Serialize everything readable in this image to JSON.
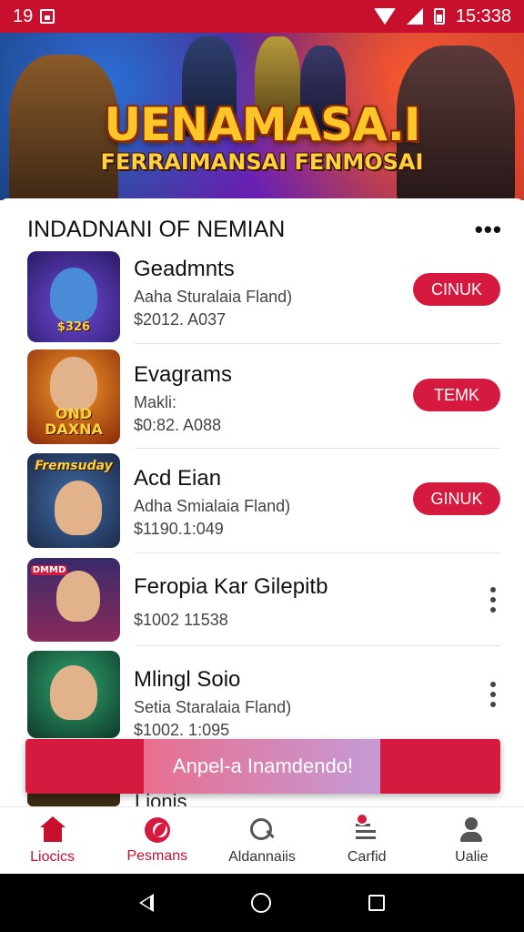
{
  "status_bar": {
    "left_text": "19",
    "time": "15:338"
  },
  "banner": {
    "title": "UENAMASA.I",
    "subtitle": "FERRAIMANSAI FENMOSAI"
  },
  "section": {
    "title": "INDADNANI OF NEMIAN"
  },
  "items": [
    {
      "name": "Geadmnts",
      "desc": "Aaha Sturalaia Fland)",
      "price": "$2012. A037",
      "action": "CINUK",
      "art_text": "$326"
    },
    {
      "name": "Evagrams",
      "desc": "Makli:",
      "price": "$0:82. A088",
      "action": "TEMK",
      "art_text": "OND DAXNA"
    },
    {
      "name": "Acd Eian",
      "desc": "Adha Smialaia Fland)",
      "price": "$1190.1:049",
      "action": "GINUK",
      "art_text": "Fremsuday"
    },
    {
      "name": "Feropia Kar Gilepitb",
      "desc": "",
      "price": "$1002 11538",
      "action": "",
      "art_text": "DMMD"
    },
    {
      "name": "Mlingl Soio",
      "desc": "Setia Staralaia Fland)",
      "price": "$1002. 1:095",
      "action": "",
      "art_text": ""
    }
  ],
  "peek_item": {
    "name": "Lionis"
  },
  "snackbar": {
    "text": "Anpel-a Inamdendo!"
  },
  "bottom_nav": [
    {
      "label": "Liocics",
      "icon": "home-icon",
      "active": true
    },
    {
      "label": "Pesmans",
      "icon": "compass-icon",
      "active": false
    },
    {
      "label": "Aldannaiis",
      "icon": "search-icon",
      "active": false
    },
    {
      "label": "Carfid",
      "icon": "list-icon",
      "active": false
    },
    {
      "label": "Ualie",
      "icon": "user-icon",
      "active": false
    }
  ],
  "colors": {
    "brand": "#c8102e",
    "pill": "#d6193e"
  }
}
